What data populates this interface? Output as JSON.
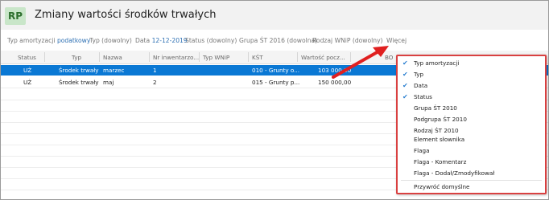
{
  "app": {
    "logo": "RP",
    "title": "Zmiany wartości środków trwałych"
  },
  "filters": {
    "amort_label": "Typ amortyzacji",
    "amort_value": "podatkowy",
    "typ": "Typ (dowolny)",
    "data_label": "Data",
    "data_value": "12-12-2019",
    "status": "Status (dowolny)",
    "grupa": "Grupa ŚT 2016 (dowolna)",
    "rodzaj": "Rodzaj WNiP (dowolny)",
    "wiecej": "Więcej"
  },
  "table": {
    "headers": [
      "Status",
      "Typ",
      "Nazwa",
      "Nr inwentarzo...",
      "Typ WNiP",
      "KŚT",
      "Wartość pocz...",
      "BO"
    ],
    "rows": [
      {
        "status": "UŻ",
        "typ": "Środek trwały",
        "nazwa": "marzec",
        "nr": "1",
        "typ_wnip": "",
        "kst": "010 - Grunty o...",
        "wartosc": "103 000,00",
        "bo": ""
      },
      {
        "status": "UŻ",
        "typ": "Środek trwały",
        "nazwa": "maj",
        "nr": "2",
        "typ_wnip": "",
        "kst": "015 - Grunty p...",
        "wartosc": "150 000,00",
        "bo": ""
      }
    ]
  },
  "menu": {
    "items": [
      {
        "label": "Typ amortyzacji",
        "checked": true
      },
      {
        "label": "Typ",
        "checked": true
      },
      {
        "label": "Data",
        "checked": true
      },
      {
        "label": "Status",
        "checked": true
      },
      {
        "label": "Grupa ŚT 2010",
        "checked": false
      },
      {
        "label": "Podgrupa ŚT 2010",
        "checked": false
      },
      {
        "label": "Rodzaj ŚT 2010",
        "checked": false
      },
      {
        "label": "Element słownika",
        "checked": false
      },
      {
        "label": "Flaga",
        "checked": false
      },
      {
        "label": "Flaga - Komentarz",
        "checked": false
      },
      {
        "label": "Flaga - Dodał/Zmodyfikował",
        "checked": false
      }
    ],
    "reset": "Przywróć domyślne",
    "check_icon": "checkmark-icon"
  },
  "colors": {
    "selection": "#0a78d4",
    "link": "#2c6fb3",
    "highlight_border": "#d94040",
    "arrow": "#e02020",
    "logo_bg": "#c9e6c9"
  }
}
